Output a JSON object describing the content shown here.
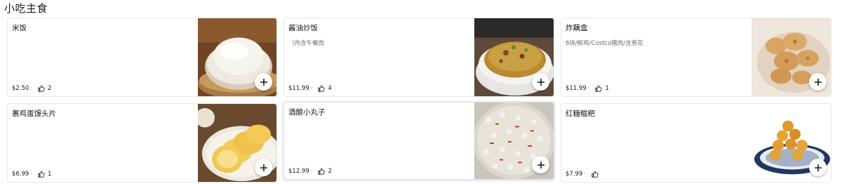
{
  "section": {
    "title": "小吃主食"
  },
  "items": [
    {
      "name": "米饭",
      "desc": "",
      "price": "$2.50",
      "likes": "2"
    },
    {
      "name": "酱油炒饭",
      "desc": "（内含午餐肉",
      "price": "$11.99",
      "likes": "4"
    },
    {
      "name": "炸藕盒",
      "desc": "6块/鲜鸡/Costco猪肉/含葱花",
      "price": "$11.99",
      "likes": "1"
    },
    {
      "name": "裹鸡蛋馒头片",
      "desc": "",
      "price": "$6.99",
      "likes": "1"
    },
    {
      "name": "酒酿小丸子",
      "desc": "",
      "price": "$12.99",
      "likes": "2"
    },
    {
      "name": "红糖糍粑",
      "desc": "",
      "price": "$7.99",
      "likes": ""
    }
  ],
  "icons": {
    "like": "thumbs-up-icon",
    "add": "plus-icon"
  },
  "colors": {
    "text": "#191919",
    "muted": "#6b6b6b",
    "border": "#e8e8e8"
  }
}
